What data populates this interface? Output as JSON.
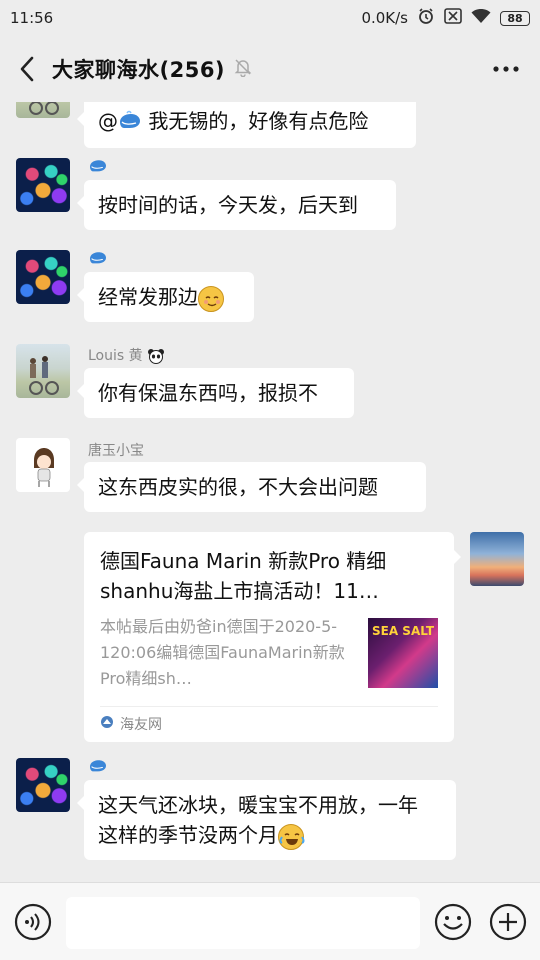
{
  "status_bar": {
    "time": "11:56",
    "network_speed": "0.0K/s",
    "battery": "88",
    "icons": [
      "alarm-icon",
      "sim-off-icon",
      "wifi-icon",
      "battery-icon"
    ]
  },
  "header": {
    "title": "大家聊海水(256)",
    "icons": [
      "back-arrow-icon",
      "mute-bell-icon",
      "more-menu-icon"
    ]
  },
  "messages": [
    {
      "sender": "",
      "text_prefix": "@",
      "text": " 我无锡的，好像有点危险",
      "avatar": "louis-photo"
    },
    {
      "sender": "",
      "text": "按时间的话，今天发，后天到",
      "avatar": "coral-photo"
    },
    {
      "sender": "",
      "text": "经常发那边",
      "emoji": "smiling-face-emoji",
      "avatar": "coral-photo"
    },
    {
      "sender": "Louis 黄",
      "text": "你有保温东西吗，报损不",
      "avatar": "louis-photo"
    },
    {
      "sender": "唐玉小宝",
      "text": "这东西皮实的很，不大会出问题",
      "avatar": "cartoon-girl"
    },
    {
      "sender": "",
      "text_line1": "这天气还冰块，暖宝宝不用放，一年",
      "text_line2": "这样的季节没两个月",
      "emoji": "laughing-tears-emoji",
      "avatar": "coral-photo"
    }
  ],
  "link_card": {
    "title": "德国Fauna Marin 新款Pro 精细shanhu海盐上市搞活动！11…",
    "description": "本帖最后由奶爸in德国于2020-5-120:06编辑德国FaunaMarin新款Pro精细sh…",
    "thumbnail_text": "SEA SALT",
    "source": "海友网"
  },
  "input_bar": {
    "icons": [
      "voice-icon",
      "emoji-icon",
      "plus-icon"
    ]
  }
}
